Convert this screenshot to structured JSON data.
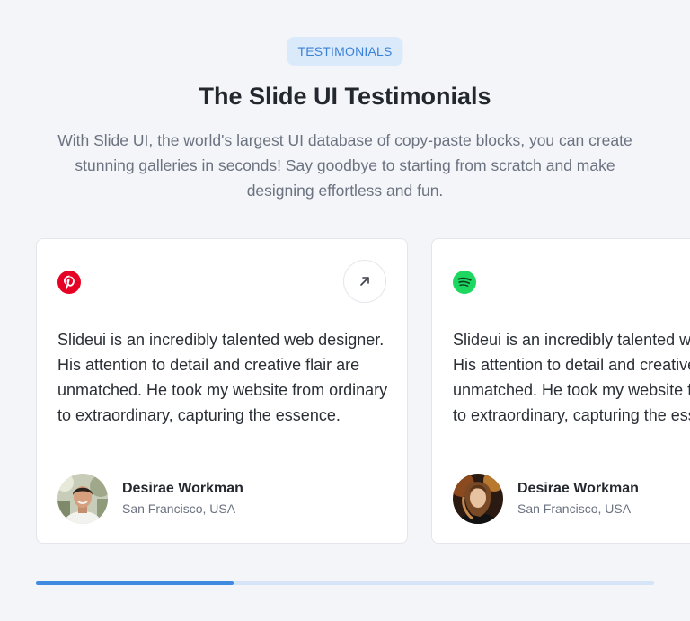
{
  "header": {
    "badge": "TESTIMONIALS",
    "title": "The Slide UI Testimonials",
    "subtitle": "With Slide UI, the world's largest UI database of copy-paste blocks, you can create stunning galleries in seconds! Say goodbye to starting from scratch and make designing effortless and fun."
  },
  "colors": {
    "accent": "#3f8be0",
    "badge_bg": "#dbeafb",
    "pinterest": "#e60023",
    "spotify": "#1ed760"
  },
  "testimonials": [
    {
      "brand_icon": "pinterest-icon",
      "action_icon": "arrow-up-right-icon",
      "quote": "Slideui is an incredibly talented web designer. His attention to detail and creative flair are unmatched. He took my website from ordinary to extraordinary, capturing the essence.",
      "name": "Desirae Workman",
      "location": "San Francisco, USA"
    },
    {
      "brand_icon": "spotify-icon",
      "quote": "Slideui is an incredibly talented web designer. His attention to detail and creative flair are unmatched. He took my website from ordinary to extraordinary, capturing the essence.",
      "name": "Desirae Workman",
      "location": "San Francisco, USA"
    }
  ],
  "carousel": {
    "progress": 0.32
  }
}
